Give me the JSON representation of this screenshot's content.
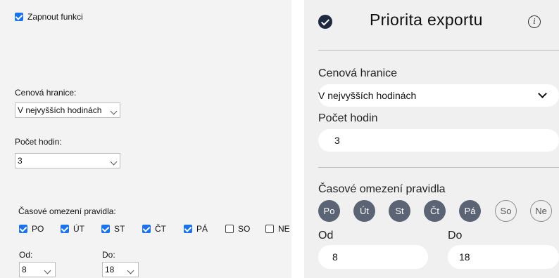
{
  "left": {
    "enable_label": "Zapnout funkci",
    "price_label": "Cenová hranice:",
    "price_value": "V nejvyšších hodinách",
    "hours_label": "Počet hodin:",
    "hours_value": "3",
    "time_label": "Časové omezení pravidla:",
    "days": [
      {
        "label": "PO",
        "checked": true
      },
      {
        "label": "ÚT",
        "checked": true
      },
      {
        "label": "ST",
        "checked": true
      },
      {
        "label": "ČT",
        "checked": true
      },
      {
        "label": "PÁ",
        "checked": true
      },
      {
        "label": "SO",
        "checked": false
      },
      {
        "label": "NE",
        "checked": false
      }
    ],
    "from_label": "Od:",
    "from_value": "8",
    "to_label": "Do:",
    "to_value": "18"
  },
  "right": {
    "title": "Priorita exportu",
    "info_glyph": "i",
    "price_label": "Cenová hranice",
    "price_value": "V nejvyšších hodinách",
    "hours_label": "Počet hodin",
    "hours_value": "3",
    "time_label": "Časové omezení pravidla",
    "days": [
      {
        "label": "Po",
        "selected": true
      },
      {
        "label": "Út",
        "selected": true
      },
      {
        "label": "St",
        "selected": true
      },
      {
        "label": "Čt",
        "selected": true
      },
      {
        "label": "Pá",
        "selected": true
      },
      {
        "label": "So",
        "selected": false
      },
      {
        "label": "Ne",
        "selected": false
      }
    ],
    "from_label": "Od",
    "from_value": "8",
    "to_label": "Do",
    "to_value": "18"
  },
  "colors": {
    "checkbox_accent": "#1a73e8",
    "day_selected": "#5b6474",
    "header_check": "#1f2a40"
  }
}
